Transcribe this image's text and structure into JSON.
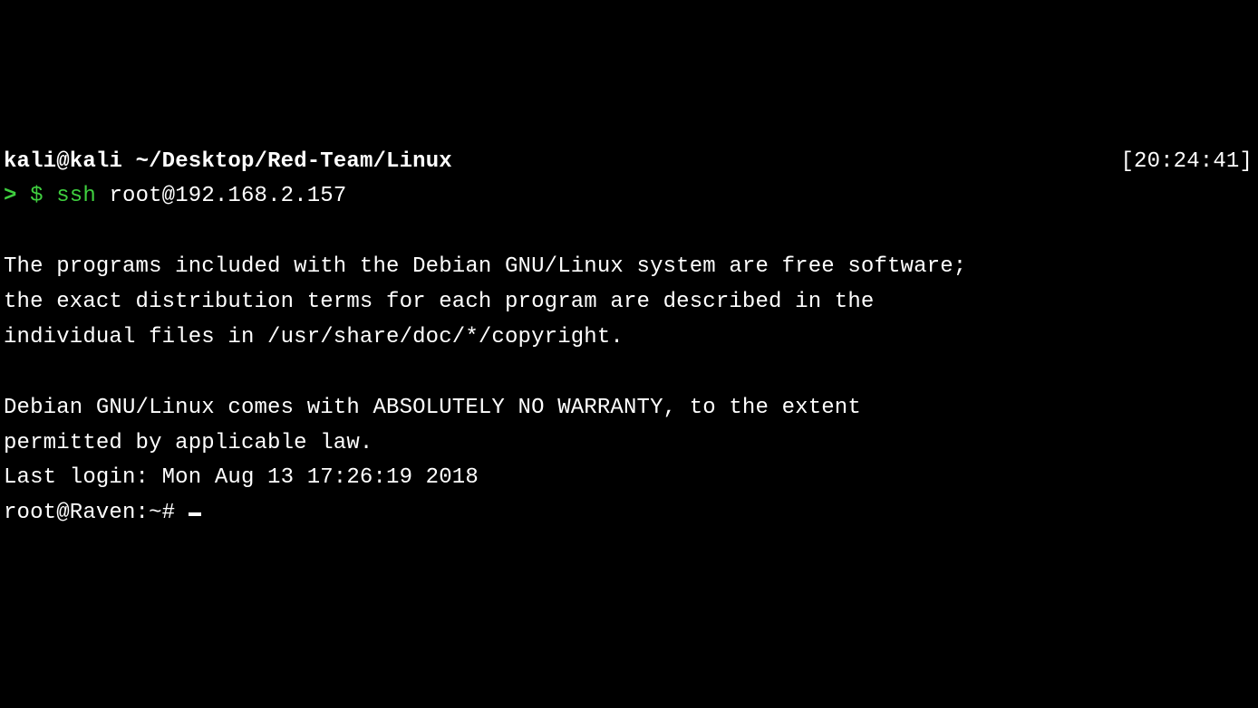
{
  "prompt": {
    "user": "kali",
    "at": "@",
    "host": "kali",
    "path_sep": " ",
    "cwd": "~/Desktop/Red-Team/Linux",
    "timestamp": "[20:24:41]",
    "arrow": ">",
    "dollar": " $ ",
    "command_prefix": "ssh",
    "command_args": " root@192.168.2.157"
  },
  "motd": {
    "line1": "The programs included with the Debian GNU/Linux system are free software;",
    "line2": "the exact distribution terms for each program are described in the",
    "line3": "individual files in /usr/share/doc/*/copyright.",
    "line4": "Debian GNU/Linux comes with ABSOLUTELY NO WARRANTY, to the extent",
    "line5": "permitted by applicable law.",
    "last_login": "Last login: Mon Aug 13 17:26:19 2018",
    "remote_prompt": "root@Raven:~# "
  }
}
